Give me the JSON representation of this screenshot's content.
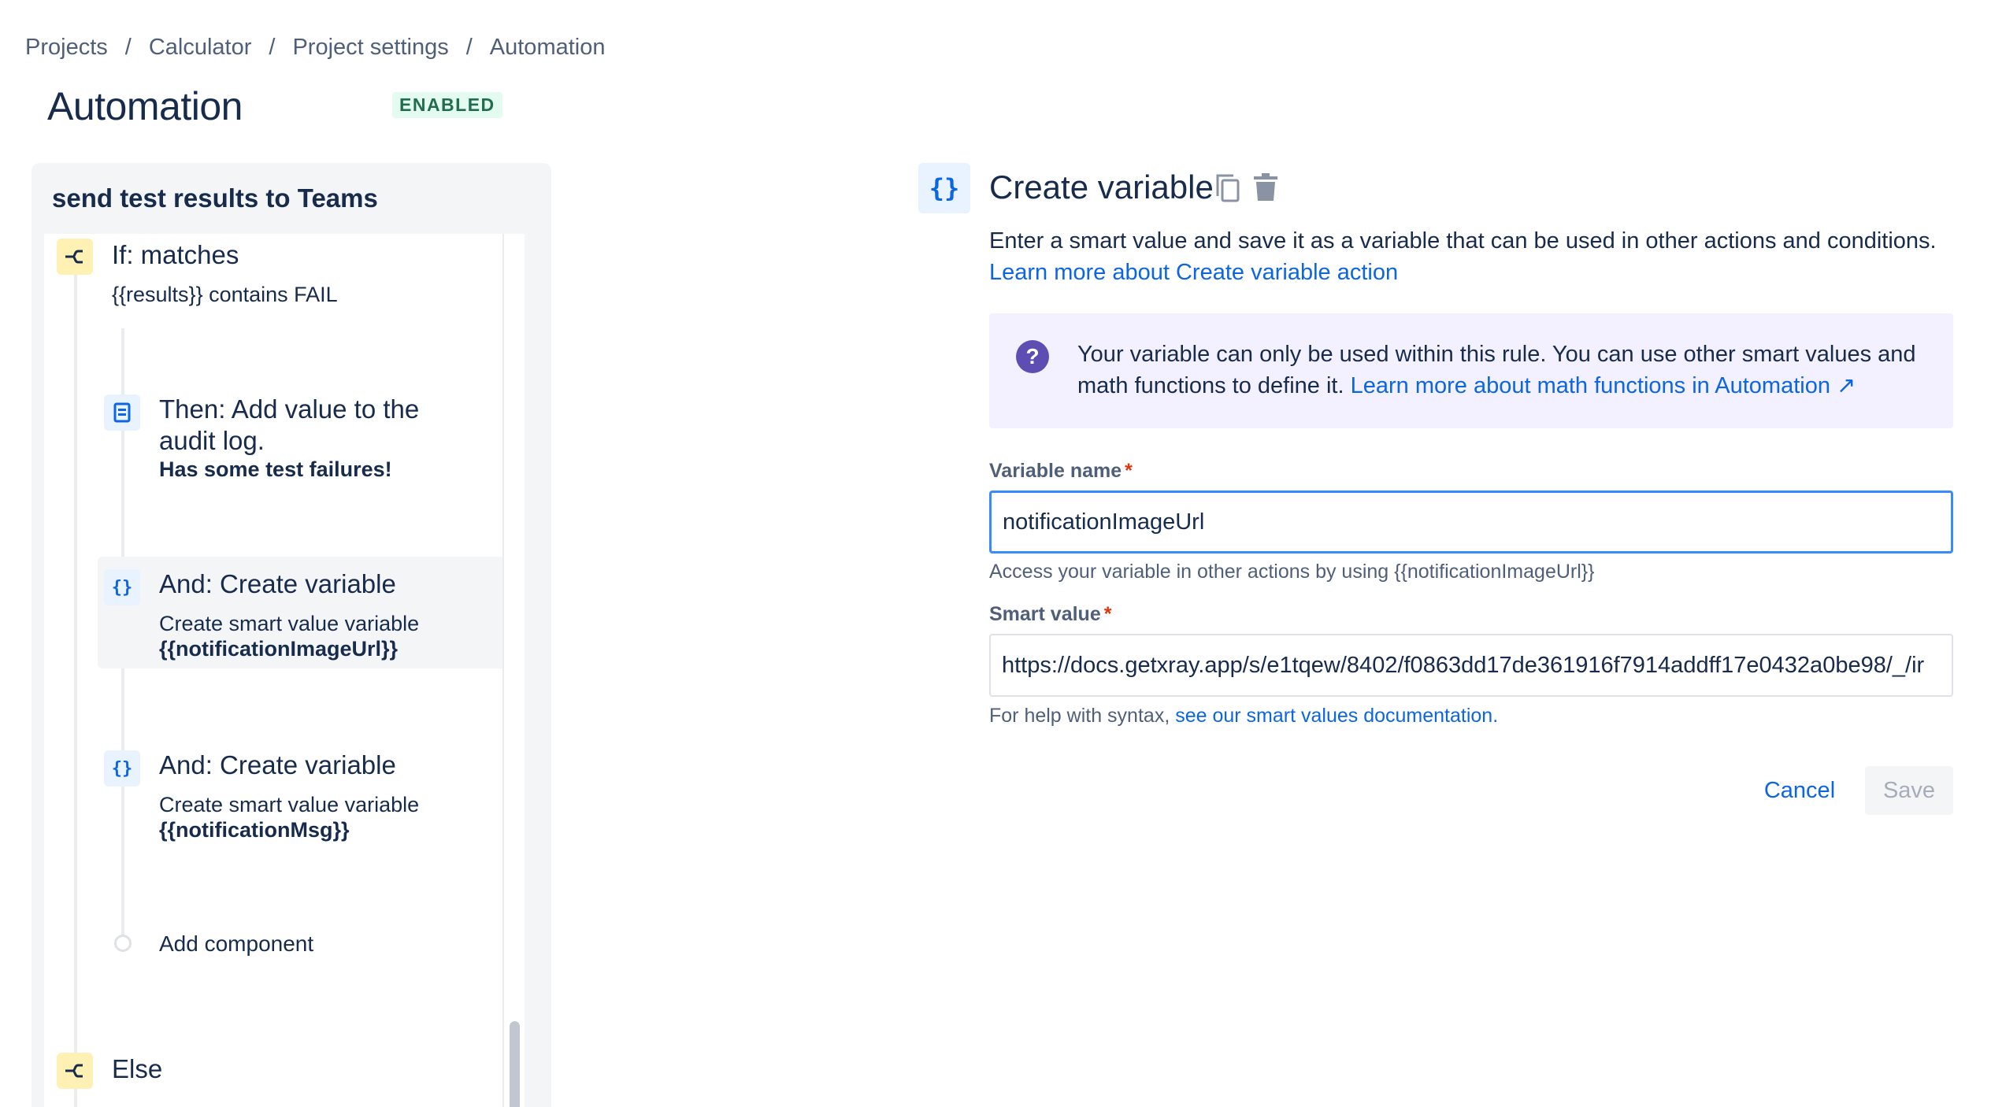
{
  "breadcrumb": {
    "items": [
      "Projects",
      "Calculator",
      "Project settings",
      "Automation"
    ],
    "separator": "/"
  },
  "page": {
    "title": "Automation",
    "status": "ENABLED"
  },
  "rule": {
    "name": "send test results to Teams",
    "steps": {
      "if": {
        "icon": "branch-icon",
        "title": "If: matches",
        "desc": "{{results}} contains FAIL"
      },
      "audit": {
        "icon": "audit-log-icon",
        "title_line1": "Then: Add value to the",
        "title_line2": "audit log.",
        "bold": "Has some test failures!"
      },
      "var1": {
        "icon": "curly-braces-icon",
        "glyph": "{}",
        "title": "And: Create variable",
        "desc": "Create smart value variable",
        "bold": "{{notificationImageUrl}}"
      },
      "var2": {
        "icon": "curly-braces-icon",
        "glyph": "{}",
        "title": "And: Create variable",
        "desc": "Create smart value variable",
        "bold": "{{notificationMsg}}"
      },
      "add": {
        "label": "Add component"
      },
      "else": {
        "icon": "branch-icon",
        "title": "Else"
      }
    }
  },
  "detail": {
    "icon_glyph": "{}",
    "title": "Create variable",
    "description": "Enter a smart value and save it as a variable that can be used in other actions and conditions.",
    "learn_link": "Learn more about Create variable action",
    "info": {
      "icon_glyph": "?",
      "text": "Your variable can only be used within this rule. You can use other smart values and math functions to define it. ",
      "link": "Learn more about math functions in Automation ↗"
    },
    "variable_name": {
      "label": "Variable name",
      "required_mark": "*",
      "value": "notificationImageUrl",
      "help": "Access your variable in other actions by using {{notificationImageUrl}}"
    },
    "smart_value": {
      "label": "Smart value",
      "required_mark": "*",
      "value": "https://docs.getxray.app/s/e1tqew/8402/f0863dd17de361916f7914addff17e0432a0be98/_/ir",
      "help_prefix": "For help with syntax, ",
      "help_link": "see our smart values documentation."
    },
    "buttons": {
      "cancel": "Cancel",
      "save": "Save"
    }
  },
  "colors": {
    "link": "#0c66e4",
    "badge_bg": "#e3fcef",
    "badge_text": "#216e4e",
    "info_bg": "#f3f0ff",
    "info_icon": "#5e4db2",
    "condition_icon_bg": "#fff0b3",
    "action_icon_bg": "#e9f2ff",
    "focus_border": "#388bff"
  }
}
